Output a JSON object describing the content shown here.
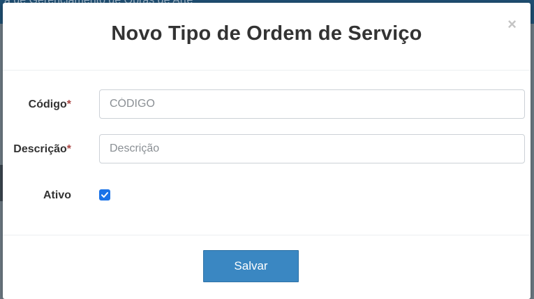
{
  "background": {
    "app_title_fragment": "a de Gerenciamento de Obras de Arte"
  },
  "modal": {
    "title": "Novo Tipo de Ordem de Serviço",
    "close_symbol": "×",
    "fields": {
      "codigo": {
        "label": "Código",
        "required_mark": "*",
        "value": "",
        "placeholder": "CÓDIGO"
      },
      "descricao": {
        "label": "Descrição",
        "required_mark": "*",
        "value": "",
        "placeholder": "Descrição"
      },
      "ativo": {
        "label": "Ativo",
        "checked": true
      }
    },
    "save_label": "Salvar"
  },
  "colors": {
    "primary_button": "#3a87c2",
    "required_mark": "#a94442",
    "checkbox": "#1a73e8"
  }
}
